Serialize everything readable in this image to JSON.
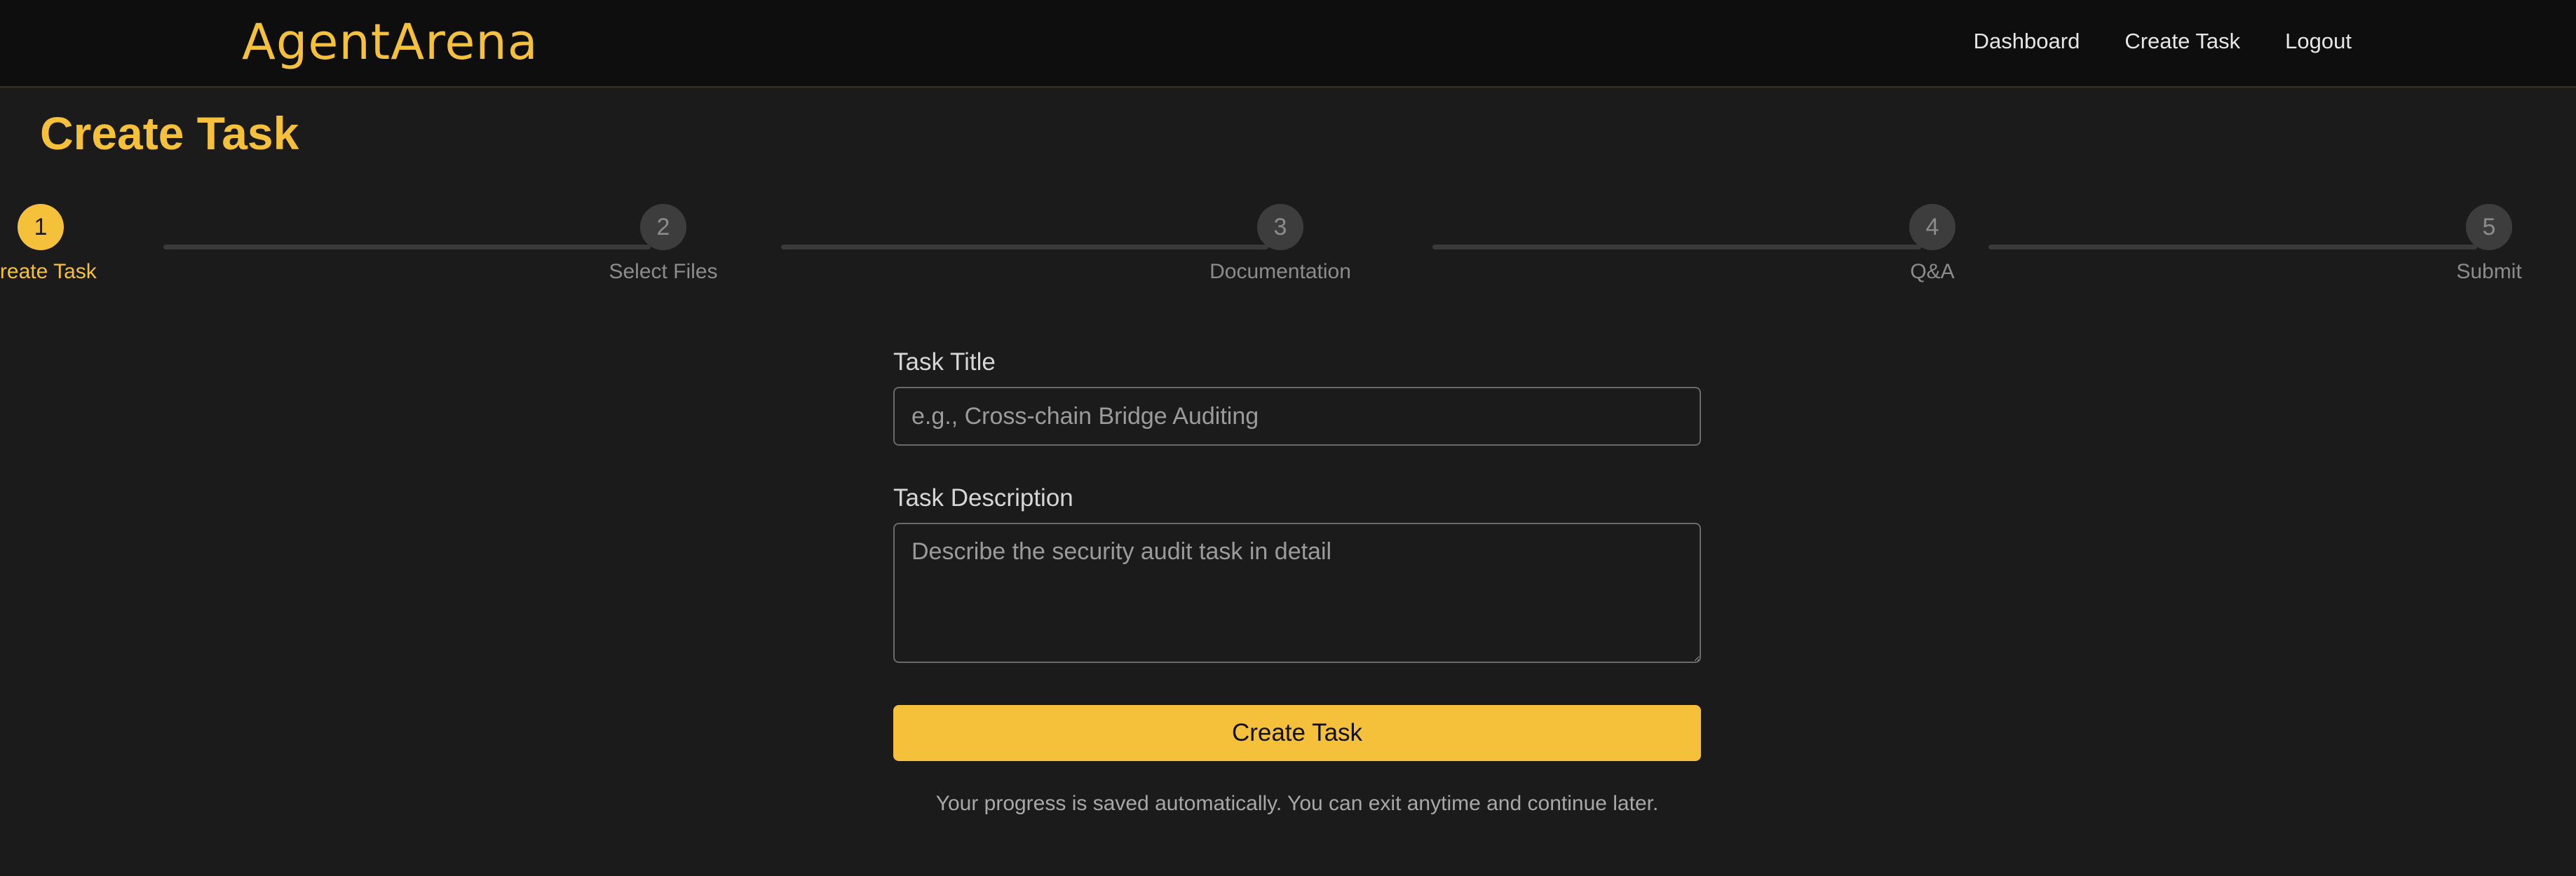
{
  "header": {
    "logo": "AgentArena",
    "nav": [
      "Dashboard",
      "Create Task",
      "Logout"
    ]
  },
  "page": {
    "title": "Create Task"
  },
  "stepper": {
    "current_step": 1,
    "steps": [
      {
        "number": "1",
        "label": "Create Task"
      },
      {
        "number": "2",
        "label": "Select Files"
      },
      {
        "number": "3",
        "label": "Documentation"
      },
      {
        "number": "4",
        "label": "Q&A"
      },
      {
        "number": "5",
        "label": "Submit"
      }
    ]
  },
  "form": {
    "title_label": "Task Title",
    "title_placeholder": "e.g., Cross-chain Bridge Auditing",
    "title_value": "",
    "description_label": "Task Description",
    "description_placeholder": "Describe the security audit task in detail",
    "description_value": "",
    "submit_label": "Create Task",
    "hint": "Your progress is saved automatically. You can exit anytime and continue later."
  },
  "colors": {
    "accent": "#f5c13b",
    "background": "#1b1b1b",
    "header_background": "#0e0e0e"
  }
}
